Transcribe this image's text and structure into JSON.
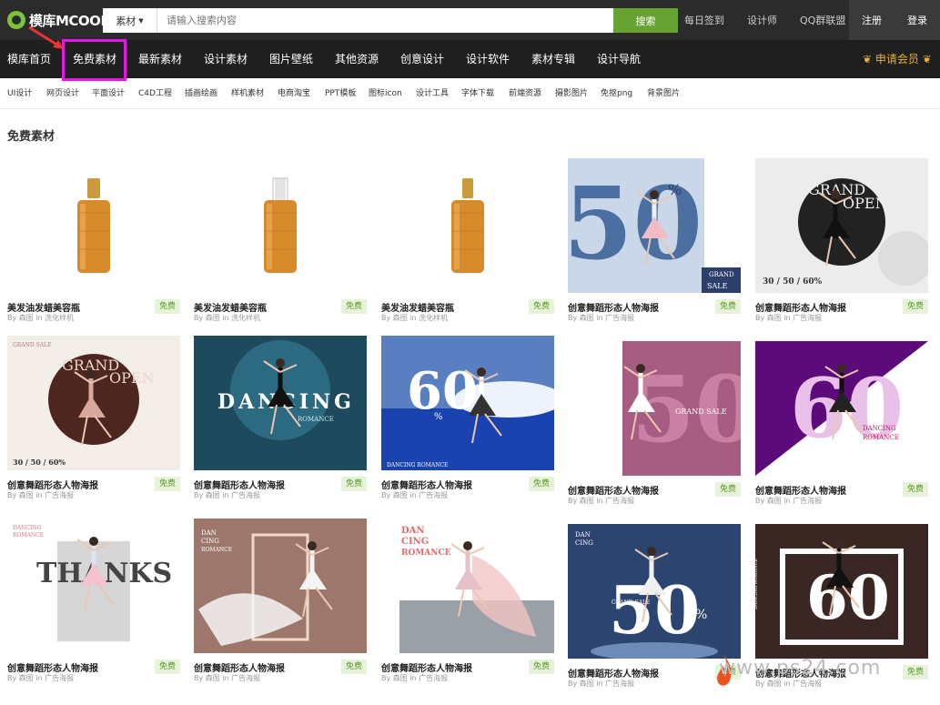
{
  "logo": {
    "text": "模库MCOOL"
  },
  "search": {
    "category": "素材",
    "placeholder": "请输入搜索内容",
    "button": "搜索"
  },
  "top_links": [
    "每日签到",
    "设计师",
    "QQ群联盟"
  ],
  "auth": {
    "register": "注册",
    "login": "登录"
  },
  "nav": {
    "items": [
      "模库首页",
      "免费素材",
      "最新素材",
      "设计素材",
      "图片壁纸",
      "其他资源",
      "创意设计",
      "设计软件",
      "素材专辑",
      "设计导航"
    ],
    "vip": "申请会员"
  },
  "subnav": [
    "UI设计",
    "网页设计",
    "平面设计",
    "C4D工程",
    "插画绘画",
    "样机素材",
    "电商淘宝",
    "PPT模板",
    "图标icon",
    "设计工具",
    "字体下载",
    "前端资源",
    "摄影图片",
    "免抠png",
    "背景图片"
  ],
  "section_title": "免费素材",
  "meta": {
    "by": "By",
    "in": "in"
  },
  "badge": "免费",
  "cards": [
    {
      "title": "美发油发蜡美容瓶",
      "author": "森图",
      "category": "洗化样机",
      "thumb": "bottle1"
    },
    {
      "title": "美发油发蜡美容瓶",
      "author": "森图",
      "category": "洗化样机",
      "thumb": "bottle2"
    },
    {
      "title": "美发油发蜡美容瓶",
      "author": "森图",
      "category": "洗化样机",
      "thumb": "bottle3"
    },
    {
      "title": "创意舞蹈形态人物海报",
      "author": "森图",
      "category": "广告海报",
      "thumb": "p50blue"
    },
    {
      "title": "创意舞蹈形态人物海报",
      "author": "森图",
      "category": "广告海报",
      "thumb": "grandgray"
    },
    {
      "title": "创意舞蹈形态人物海报",
      "author": "森图",
      "category": "广告海报",
      "thumb": "grandbrown"
    },
    {
      "title": "创意舞蹈形态人物海报",
      "author": "森图",
      "category": "广告海报",
      "thumb": "dancingteal"
    },
    {
      "title": "创意舞蹈形态人物海报",
      "author": "森图",
      "category": "广告海报",
      "thumb": "sixtysky"
    },
    {
      "title": "创意舞蹈形态人物海报",
      "author": "森图",
      "category": "广告海报",
      "thumb": "p50pink"
    },
    {
      "title": "创意舞蹈形态人物海报",
      "author": "森图",
      "category": "广告海报",
      "thumb": "sixtymagenta"
    },
    {
      "title": "创意舞蹈形态人物海报",
      "author": "森图",
      "category": "广告海报",
      "thumb": "thanks"
    },
    {
      "title": "创意舞蹈形态人物海报",
      "author": "森图",
      "category": "广告海报",
      "thumb": "danbrown"
    },
    {
      "title": "创意舞蹈形态人物海报",
      "author": "森图",
      "category": "广告海报",
      "thumb": "dangray"
    },
    {
      "title": "创意舞蹈形态人物海报",
      "author": "森图",
      "category": "广告海报",
      "thumb": "p50navy"
    },
    {
      "title": "创意舞蹈形态人物海报",
      "author": "森图",
      "category": "广告海报",
      "thumb": "sixtydark"
    }
  ],
  "thumb_text": {
    "p50blue": {
      "big": "50",
      "pct": "%",
      "small": "GRAND",
      "small2": "SALE"
    },
    "grandgray": {
      "big": "GRAND",
      "big2": "OPEN",
      "small": "30 / 50 / 60%"
    },
    "grandbrown": {
      "small": "GRAND SALE",
      "big": "GRAND",
      "big2": "OPEN",
      "small2": "30 / 50 / 60%"
    },
    "dancingteal": {
      "big": "DANCING",
      "small": "ROMANCE"
    },
    "sixtysky": {
      "big": "60",
      "pct": "%",
      "small": "DANCING ROMANCE"
    },
    "p50pink": {
      "big": "50",
      "small": "GRAND  SALE"
    },
    "sixtymagenta": {
      "big": "60",
      "small": "DANCING",
      "small2": "ROMANCE"
    },
    "thanks": {
      "big": "THANKS",
      "small": "DANCING",
      "small2": "ROMANCE"
    },
    "danbrown": {
      "small": "DAN",
      "small2": "CING",
      "small3": "ROMANCE"
    },
    "dangray": {
      "small": "DAN",
      "small2": "CING",
      "small3": "ROMANCE"
    },
    "p50navy": {
      "big": "50",
      "pct": "%",
      "small": "GRAND SALE",
      "small2": "DAN",
      "small3": "CING"
    },
    "sixtydark": {
      "big": "60",
      "pct": "%",
      "small": "DANCING ROMANCE"
    }
  },
  "watermark": "www.ps24.com",
  "colors": {
    "accent_green": "#67a332",
    "nav_bg": "#1f1f1f",
    "top_bg": "#2b2b2b",
    "highlight": "#e318e6",
    "vip_gold": "#e7b13c"
  }
}
